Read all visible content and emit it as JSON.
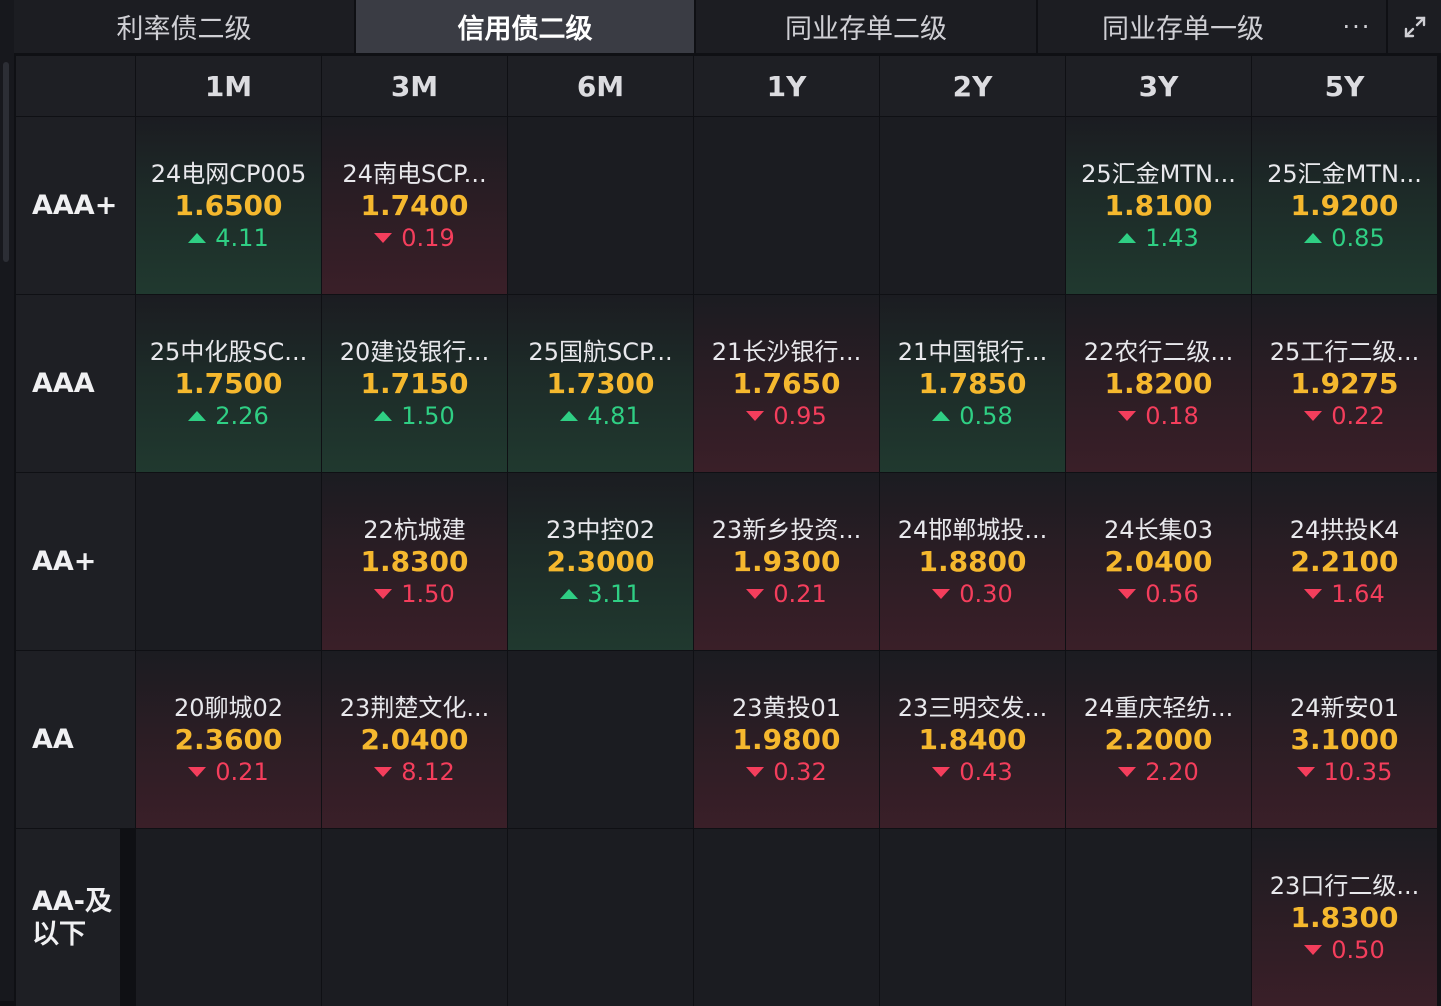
{
  "tabs": [
    {
      "label": "利率债二级",
      "active": false
    },
    {
      "label": "信用债二级",
      "active": true
    },
    {
      "label": "同业存单二级",
      "active": false
    },
    {
      "label": "同业存单一级",
      "active": false
    }
  ],
  "more_label": "···",
  "tenors": [
    "1M",
    "3M",
    "6M",
    "1Y",
    "2Y",
    "3Y",
    "5Y"
  ],
  "ratings": [
    "AAA+",
    "AAA",
    "AA+",
    "AA",
    "AA-及以下"
  ],
  "colors": {
    "yield": "#f5b82e",
    "up": "#2fcf84",
    "down": "#f43e5c"
  },
  "rows": [
    [
      {
        "name": "24电网CP005",
        "yield": "1.6500",
        "change": "4.11",
        "dir": "up"
      },
      {
        "name": "24南电SCP...",
        "yield": "1.7400",
        "change": "0.19",
        "dir": "down"
      },
      null,
      null,
      null,
      {
        "name": "25汇金MTN...",
        "yield": "1.8100",
        "change": "1.43",
        "dir": "up"
      },
      {
        "name": "25汇金MTN...",
        "yield": "1.9200",
        "change": "0.85",
        "dir": "up"
      }
    ],
    [
      {
        "name": "25中化股SC...",
        "yield": "1.7500",
        "change": "2.26",
        "dir": "up"
      },
      {
        "name": "20建设银行...",
        "yield": "1.7150",
        "change": "1.50",
        "dir": "up"
      },
      {
        "name": "25国航SCP...",
        "yield": "1.7300",
        "change": "4.81",
        "dir": "up"
      },
      {
        "name": "21长沙银行...",
        "yield": "1.7650",
        "change": "0.95",
        "dir": "down"
      },
      {
        "name": "21中国银行...",
        "yield": "1.7850",
        "change": "0.58",
        "dir": "up"
      },
      {
        "name": "22农行二级...",
        "yield": "1.8200",
        "change": "0.18",
        "dir": "down"
      },
      {
        "name": "25工行二级...",
        "yield": "1.9275",
        "change": "0.22",
        "dir": "down"
      }
    ],
    [
      null,
      {
        "name": "22杭城建",
        "yield": "1.8300",
        "change": "1.50",
        "dir": "down"
      },
      {
        "name": "23中控02",
        "yield": "2.3000",
        "change": "3.11",
        "dir": "up"
      },
      {
        "name": "23新乡投资...",
        "yield": "1.9300",
        "change": "0.21",
        "dir": "down"
      },
      {
        "name": "24邯郸城投...",
        "yield": "1.8800",
        "change": "0.30",
        "dir": "down"
      },
      {
        "name": "24长集03",
        "yield": "2.0400",
        "change": "0.56",
        "dir": "down"
      },
      {
        "name": "24拱投K4",
        "yield": "2.2100",
        "change": "1.64",
        "dir": "down"
      }
    ],
    [
      {
        "name": "20聊城02",
        "yield": "2.3600",
        "change": "0.21",
        "dir": "down"
      },
      {
        "name": "23荆楚文化...",
        "yield": "2.0400",
        "change": "8.12",
        "dir": "down"
      },
      null,
      {
        "name": "23黄投01",
        "yield": "1.9800",
        "change": "0.32",
        "dir": "down"
      },
      {
        "name": "23三明交发...",
        "yield": "1.8400",
        "change": "0.43",
        "dir": "down"
      },
      {
        "name": "24重庆轻纺...",
        "yield": "2.2000",
        "change": "2.20",
        "dir": "down"
      },
      {
        "name": "24新安01",
        "yield": "3.1000",
        "change": "10.35",
        "dir": "down"
      }
    ],
    [
      null,
      null,
      null,
      null,
      null,
      null,
      {
        "name": "23口行二级...",
        "yield": "1.8300",
        "change": "0.50",
        "dir": "down"
      }
    ]
  ]
}
